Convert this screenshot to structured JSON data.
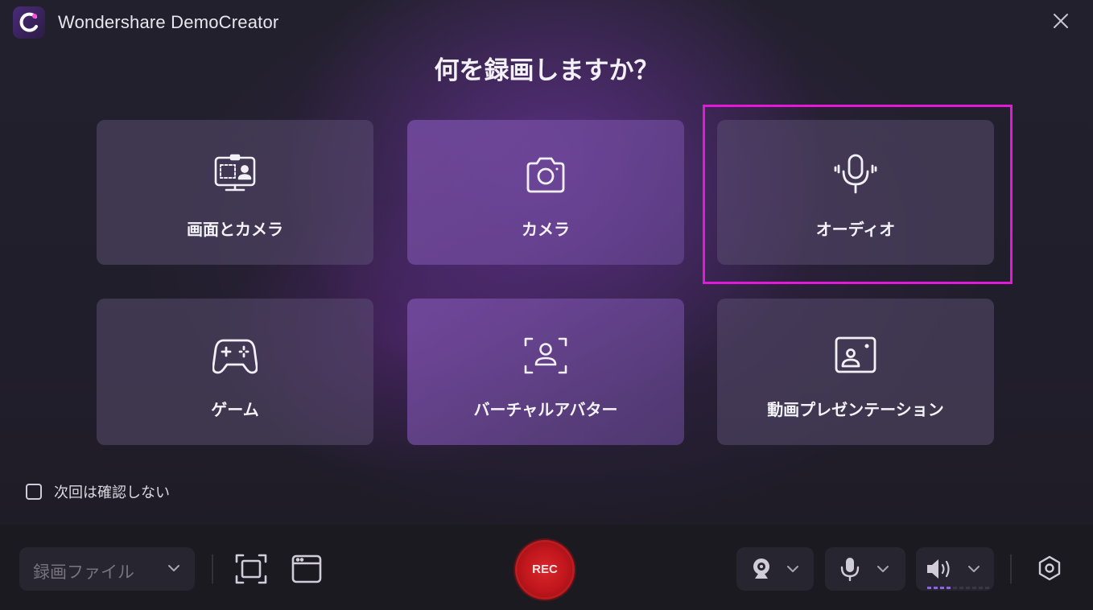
{
  "window": {
    "title": "Wondershare DemoCreator",
    "close_icon": "close-icon"
  },
  "heading": "何を録画しますか？",
  "modes": [
    {
      "label": "画面とカメラ",
      "icon": "screen-camera-icon"
    },
    {
      "label": "カメラ",
      "icon": "camera-icon"
    },
    {
      "label": "オーディオ",
      "icon": "microphone-icon"
    },
    {
      "label": "ゲーム",
      "icon": "gamepad-icon"
    },
    {
      "label": "バーチャルアバター",
      "icon": "avatar-scan-icon"
    },
    {
      "label": "動画プレゼンテーション",
      "icon": "presentation-icon"
    }
  ],
  "highlighted_mode": "オーディオ",
  "dont_ask": {
    "label": "次回は確認しない",
    "checked": false
  },
  "toolbar": {
    "output_select": "録画ファイル",
    "rec_label": "REC",
    "volume_level": 0.4
  },
  "colors": {
    "highlight_border": "#e21ad8",
    "rec_button": "#c0161c",
    "volume_active": "#8c67e0"
  }
}
